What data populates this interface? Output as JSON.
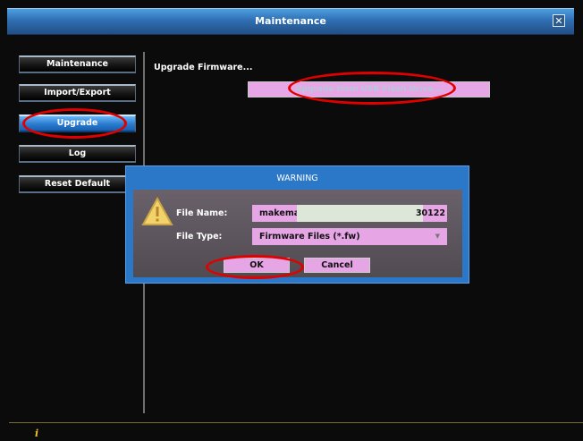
{
  "window": {
    "title": "Maintenance",
    "close_icon": "close-icon"
  },
  "sidebar": {
    "items": [
      {
        "label": "Maintenance",
        "active": false
      },
      {
        "label": "Import/Export",
        "active": false
      },
      {
        "label": "Upgrade",
        "active": true
      },
      {
        "label": "Log",
        "active": false
      },
      {
        "label": "Reset Default",
        "active": false
      }
    ]
  },
  "content": {
    "title": "Upgrade Firmware...",
    "usb_button": "Upgrade from USB Flash Drive..."
  },
  "dialog": {
    "title": "WARNING",
    "icon": "warning-icon",
    "file_name_label": "File Name:",
    "file_name_value_start": "makemake_v",
    "file_name_value_end": "30122",
    "file_type_label": "File Type:",
    "file_type_value": "Firmware Files (*.fw)",
    "ok_label": "OK",
    "cancel_label": "Cancel"
  },
  "status_bar": {
    "icon": "info-icon",
    "icon_glyph": "i"
  },
  "colors": {
    "accent": "#2b78c9",
    "highlight_ring": "#e00000",
    "field_bg": "#e6a5e4"
  }
}
